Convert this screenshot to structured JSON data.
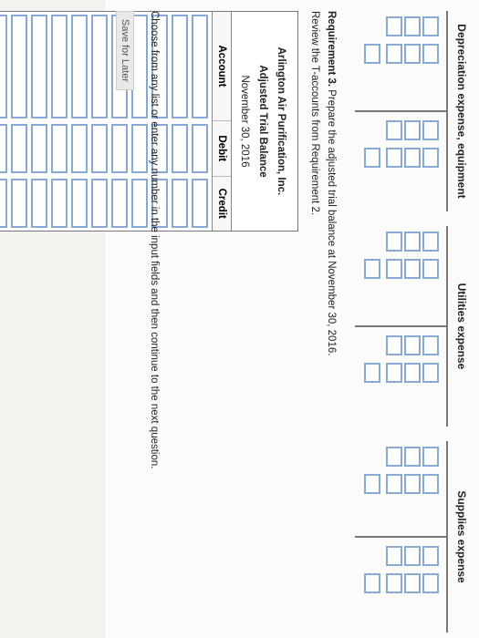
{
  "t_accounts": [
    {
      "title": "Depreciation expense, equipment"
    },
    {
      "title": "Utilities expense"
    },
    {
      "title": "Supplies expense"
    }
  ],
  "requirement": {
    "label": "Requirement 3.",
    "text": "Prepare the adjusted trial balance at November 30, 2016.",
    "review": "Review the T-accounts from Requirement 2."
  },
  "trial_balance": {
    "company": "Arlington Air Purification, Inc.",
    "title": "Adjusted Trial Balance",
    "date": "November 30, 2016",
    "columns": {
      "account": "Account",
      "debit": "Debit",
      "credit": "Credit"
    },
    "row_count": 11
  },
  "instructions": "Choose from any list or enter any number in the input fields and then continue to the next question.",
  "save_label": "Save for Later"
}
